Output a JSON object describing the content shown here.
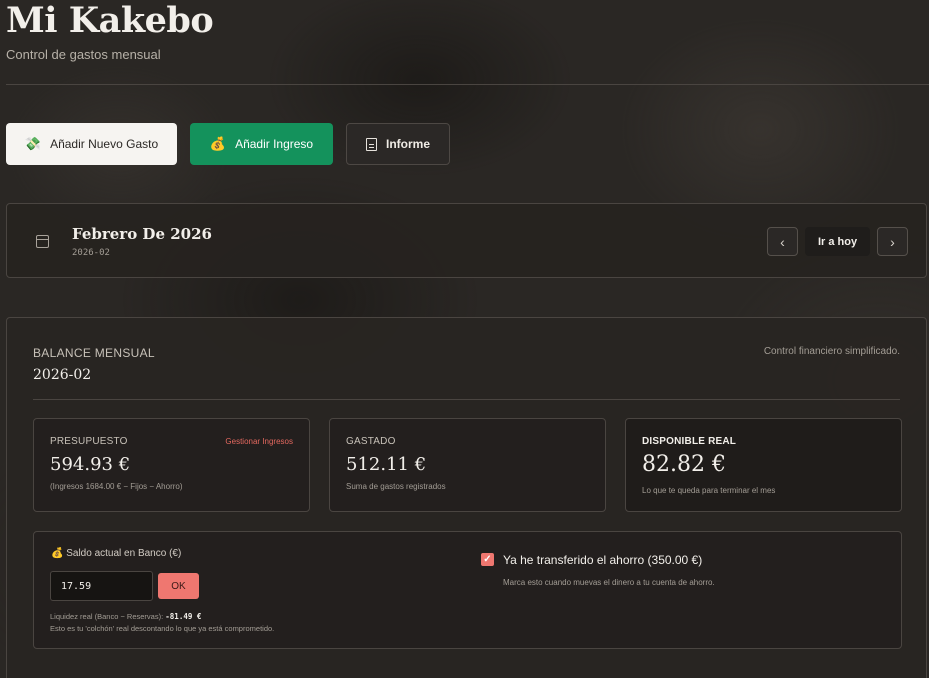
{
  "app": {
    "title": "Mi Kakebo",
    "subtitle": "Control de gastos mensual"
  },
  "actions": {
    "add_expense": {
      "label": "Añadir Nuevo Gasto",
      "icon": "💸"
    },
    "add_income": {
      "label": "Añadir Ingreso",
      "icon": "💰"
    },
    "report": {
      "label": "Informe",
      "icon": "document-icon"
    }
  },
  "month_nav": {
    "title": "Febrero De 2026",
    "code": "2026-02",
    "prev_icon": "‹",
    "next_icon": "›",
    "today_label": "Ir a hoy"
  },
  "balance": {
    "label": "BALANCE MENSUAL",
    "period": "2026-02",
    "note": "Control financiero simplificado.",
    "stats": [
      {
        "label": "PRESUPUESTO",
        "link": "Gestionar Ingresos",
        "value": "594.93 €",
        "sub": "(Ingresos 1684.00 € − Fijos − Ahorro)"
      },
      {
        "label": "GASTADO",
        "value": "512.11 €",
        "sub": "Suma de gastos registrados"
      },
      {
        "label": "DISPONIBLE REAL",
        "value": "82.82 €",
        "sub": "Lo que te queda para terminar el mes"
      }
    ],
    "bank": {
      "label": "💰 Saldo actual en Banco (€)",
      "value": "17.59",
      "ok_label": "OK",
      "liquidity_label": "Liquidez real (Banco − Reservas):",
      "liquidity_value": "-81.49 €",
      "liquidity_note": "Esto es tu 'colchón' real descontando lo que ya está comprometido."
    },
    "savings": {
      "checked": true,
      "label": "Ya he transferido el ahorro (350.00 €)",
      "note": "Marca esto cuando muevas el dinero a tu cuenta de ahorro."
    }
  },
  "colors": {
    "background": "#2a2724",
    "income_green": "#14925c",
    "accent_red": "#ef7770"
  }
}
